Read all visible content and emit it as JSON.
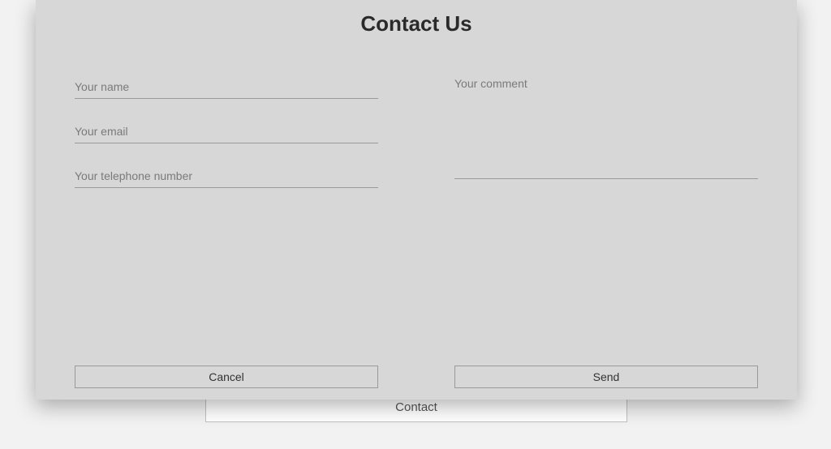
{
  "backdrop": {
    "contact_button_label": "Contact"
  },
  "dialog": {
    "title": "Contact Us",
    "fields": {
      "name_placeholder": "Your name",
      "email_placeholder": "Your email",
      "telephone_placeholder": "Your telephone number",
      "comment_placeholder": "Your comment"
    },
    "buttons": {
      "cancel_label": "Cancel",
      "send_label": "Send"
    }
  }
}
